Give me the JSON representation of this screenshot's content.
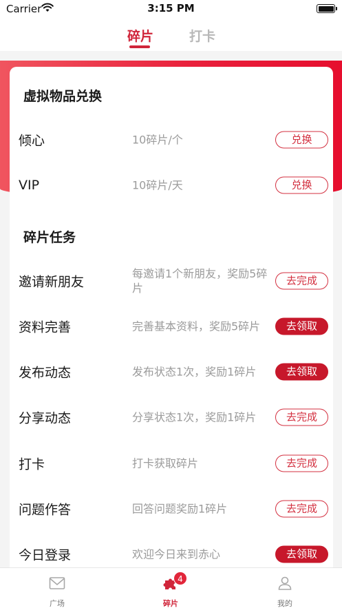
{
  "status_bar": {
    "carrier": "Carrier",
    "time": "3:15 PM"
  },
  "top_tabs": {
    "active": "碎片",
    "inactive": "打卡"
  },
  "exchange_section": {
    "title": "虚拟物品兑换",
    "items": [
      {
        "name": "倾心",
        "desc": "10碎片/个",
        "button": "兑换"
      },
      {
        "name": "VIP",
        "desc": "10碎片/天",
        "button": "兑换"
      }
    ]
  },
  "task_section": {
    "title": "碎片任务",
    "items": [
      {
        "name": "邀请新朋友",
        "desc": "每邀请1个新朋友，奖励5碎片",
        "button": "去完成",
        "filled": false
      },
      {
        "name": "资料完善",
        "desc": "完善基本资料，奖励5碎片",
        "button": "去领取",
        "filled": true
      },
      {
        "name": "发布动态",
        "desc": "发布状态1次，奖励1碎片",
        "button": "去领取",
        "filled": true
      },
      {
        "name": "分享动态",
        "desc": "分享状态1次，奖励1碎片",
        "button": "去完成",
        "filled": false
      },
      {
        "name": "打卡",
        "desc": "打卡获取碎片",
        "button": "去完成",
        "filled": false
      },
      {
        "name": "问题作答",
        "desc": "回答问题奖励1碎片",
        "button": "去完成",
        "filled": false
      },
      {
        "name": "今日登录",
        "desc": "欢迎今日来到赤心",
        "button": "去领取",
        "filled": true
      }
    ]
  },
  "bottom_tabs": {
    "plaza": {
      "label": "广场",
      "icon": "envelope-icon"
    },
    "fragment": {
      "label": "碎片",
      "icon": "puzzle-icon",
      "badge": "4"
    },
    "mine": {
      "label": "我的",
      "icon": "person-icon"
    }
  },
  "colors": {
    "accent": "#d0253a",
    "button_fill": "#c7182b",
    "header_gradient_start": "#f0555f",
    "header_gradient_end": "#e60e2e"
  }
}
